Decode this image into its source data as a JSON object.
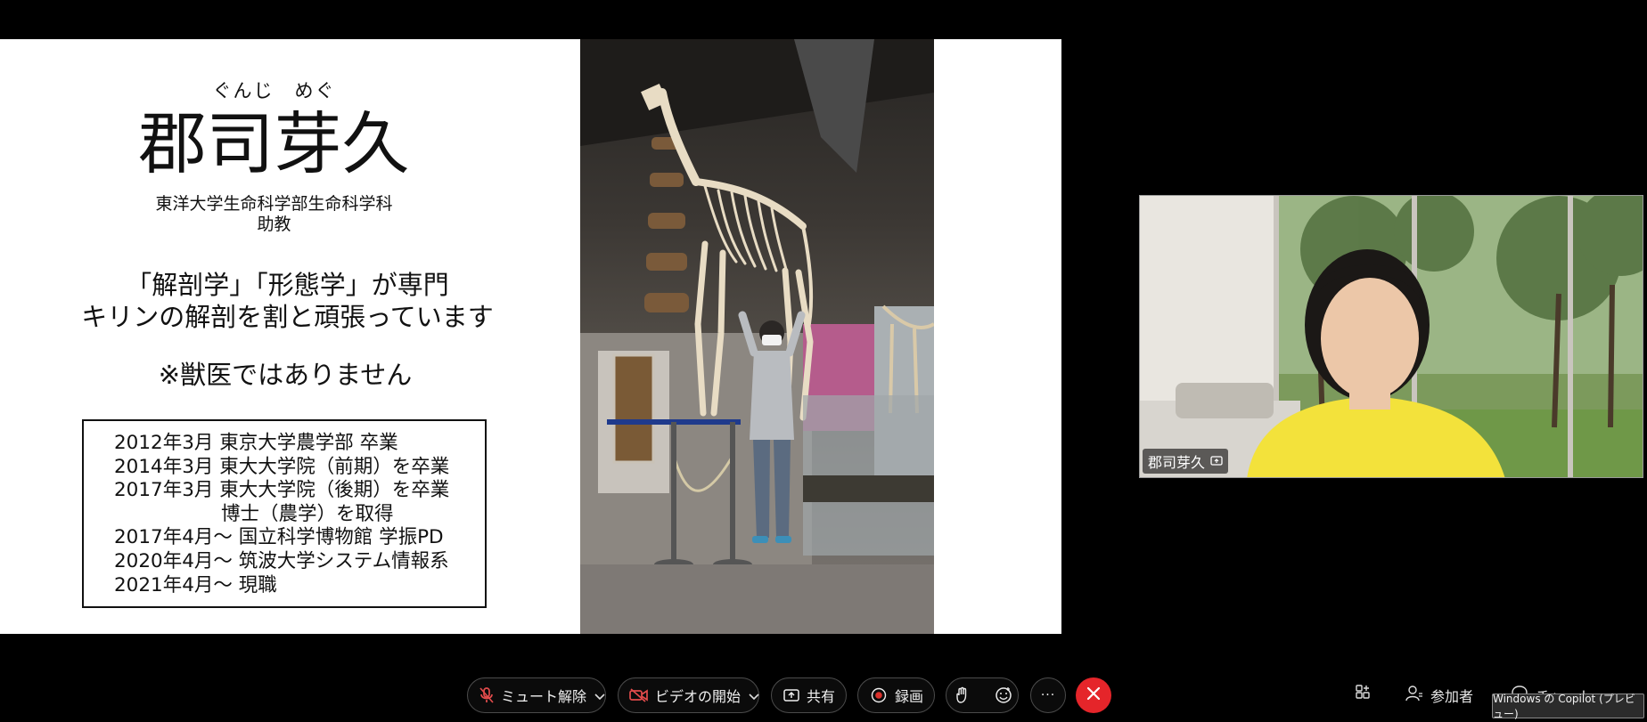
{
  "slide": {
    "furigana": "ぐんじ　めぐ",
    "name": "郡司芽久",
    "affiliation_line1": "東洋大学生命科学部生命科学科",
    "affiliation_line2": "助教",
    "specialty_line1": "「解剖学」「形態学」が専門",
    "specialty_line2": "キリンの解剖を割と頑張っています",
    "note": "※獣医ではありません",
    "career": [
      "2012年3月 東京大学農学部  卒業",
      "2014年3月 東大大学院（前期）を卒業",
      "2017年3月 東大大学院（後期）を卒業",
      "博士（農学）を取得",
      "2017年4月～ 国立科学博物館 学振PD",
      "2020年4月～ 筑波大学システム情報系",
      "2021年4月～ 現職"
    ]
  },
  "webcam": {
    "participant_name": "郡司芽久",
    "name_icon": "screen-share-icon"
  },
  "toolbar": {
    "unmute_label": "ミュート解除",
    "video_label": "ビデオの開始",
    "share_label": "共有",
    "record_label": "録画",
    "more_label": "···",
    "apps_icon": "apps-icon",
    "participants_label": "参加者",
    "chat_label": "チャット"
  },
  "tooltip": {
    "text": "Windows の Copilot (プレビュー)"
  },
  "colors": {
    "end_button": "#e5252a",
    "mute_icon": "#e24b4b",
    "video_icon": "#e24b4b",
    "record_dot": "#d9302b"
  }
}
